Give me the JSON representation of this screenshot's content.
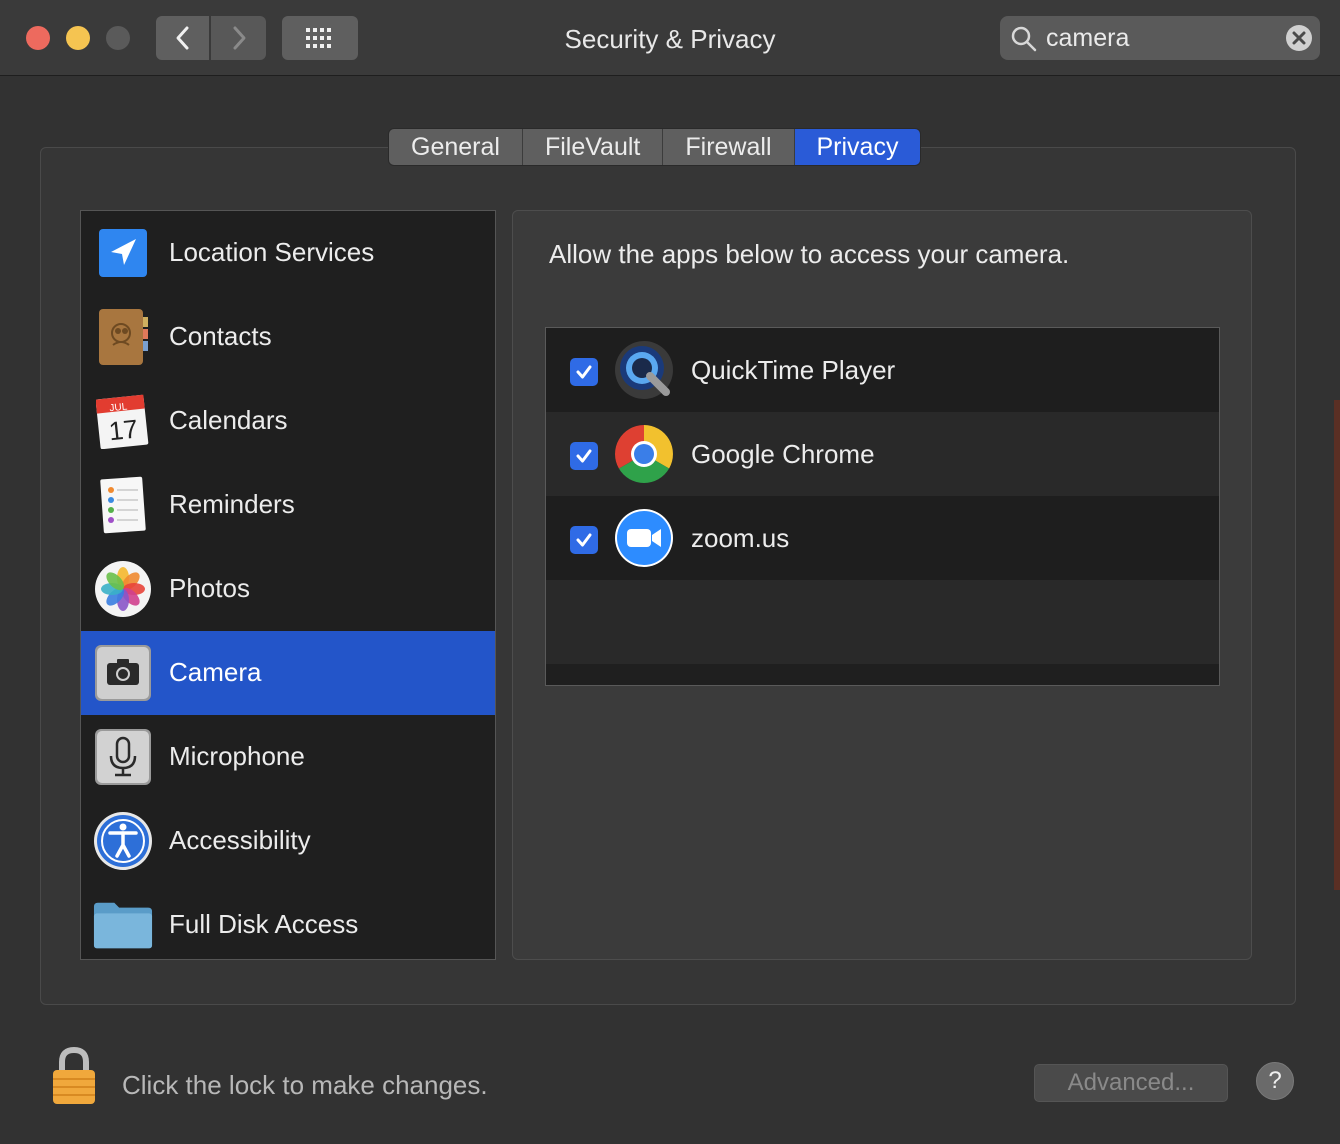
{
  "window": {
    "title": "Security & Privacy",
    "search": {
      "value": "camera",
      "placeholder": "Search"
    }
  },
  "tabs": [
    {
      "label": "General",
      "active": false
    },
    {
      "label": "FileVault",
      "active": false
    },
    {
      "label": "Firewall",
      "active": false
    },
    {
      "label": "Privacy",
      "active": true
    }
  ],
  "sidebar": {
    "selected": "Camera",
    "items": [
      {
        "label": "Location Services",
        "icon": "location-arrow-icon"
      },
      {
        "label": "Contacts",
        "icon": "contacts-book-icon"
      },
      {
        "label": "Calendars",
        "icon": "calendar-icon",
        "month": "JUL",
        "day": "17"
      },
      {
        "label": "Reminders",
        "icon": "reminders-icon"
      },
      {
        "label": "Photos",
        "icon": "photos-flower-icon"
      },
      {
        "label": "Camera",
        "icon": "camera-icon"
      },
      {
        "label": "Microphone",
        "icon": "microphone-icon"
      },
      {
        "label": "Accessibility",
        "icon": "accessibility-icon"
      },
      {
        "label": "Full Disk Access",
        "icon": "folder-icon"
      }
    ]
  },
  "panel": {
    "heading": "Allow the apps below to access your camera.",
    "apps": [
      {
        "name": "QuickTime Player",
        "checked": true,
        "icon": "quicktime-icon"
      },
      {
        "name": "Google Chrome",
        "checked": true,
        "icon": "chrome-icon"
      },
      {
        "name": "zoom.us",
        "checked": true,
        "icon": "zoom-icon"
      }
    ]
  },
  "footer": {
    "lock_text": "Click the lock to make changes.",
    "advanced_label": "Advanced...",
    "help_label": "?"
  },
  "colors": {
    "accent": "#2a5bd7",
    "selection": "#2355c9",
    "checkbox": "#2f6be6"
  }
}
